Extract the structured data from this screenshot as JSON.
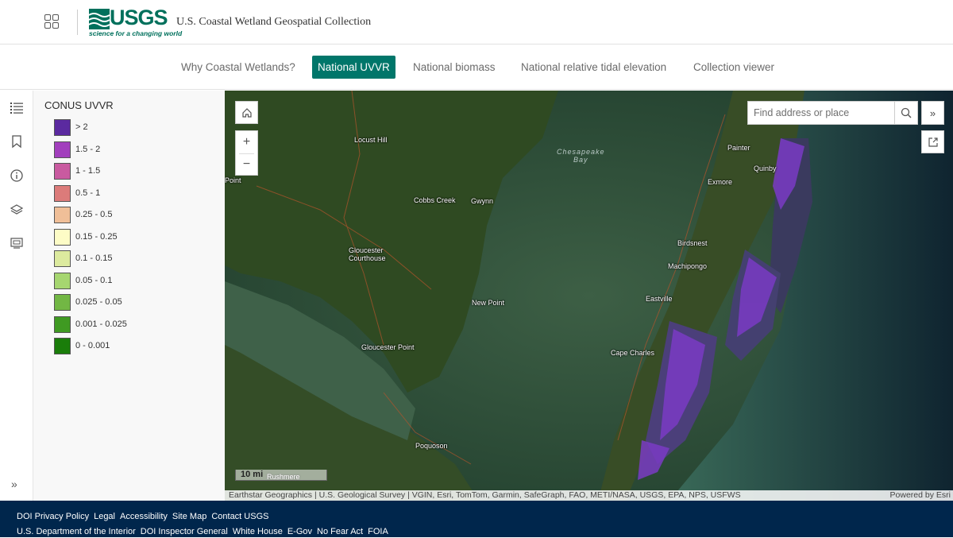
{
  "header": {
    "logo_text": "USGS",
    "logo_tagline": "science for a changing world",
    "site_title": "U.S. Coastal Wetland Geospatial Collection",
    "apps_icon": "grid-icon"
  },
  "nav": {
    "items": [
      {
        "label": "Why Coastal Wetlands?"
      },
      {
        "label": "National UVVR",
        "active": true
      },
      {
        "label": "National biomass"
      },
      {
        "label": "National relative tidal elevation"
      },
      {
        "label": "Collection viewer"
      }
    ]
  },
  "rail": {
    "icons": [
      "legend-list-icon",
      "bookmark-icon",
      "info-icon",
      "layers-icon",
      "basemap-gallery-icon"
    ],
    "expand_icon": "double-chevron-right-icon",
    "expand_label": "»"
  },
  "legend": {
    "title": "CONUS UVVR",
    "items": [
      {
        "label": "> 2",
        "color": "#5b2aa0"
      },
      {
        "label": "1.5 - 2",
        "color": "#a23fbd"
      },
      {
        "label": "1 - 1.5",
        "color": "#c95aa0"
      },
      {
        "label": "0.5 - 1",
        "color": "#dc7b7a"
      },
      {
        "label": "0.25 - 0.5",
        "color": "#f0bf98"
      },
      {
        "label": "0.15 - 0.25",
        "color": "#fdfcc6"
      },
      {
        "label": "0.1 - 0.15",
        "color": "#dcea9e"
      },
      {
        "label": "0.05 - 0.1",
        "color": "#a6d670"
      },
      {
        "label": "0.025 - 0.05",
        "color": "#72b744"
      },
      {
        "label": "0.001 - 0.025",
        "color": "#3f9a22"
      },
      {
        "label": "0 - 0.001",
        "color": "#1a7d0a"
      }
    ]
  },
  "map": {
    "water_label": "Chesapeake\nBay",
    "places": [
      {
        "label": "Point"
      },
      {
        "label": "Locust Hill"
      },
      {
        "label": "Cobbs Creek"
      },
      {
        "label": "Gwynn"
      },
      {
        "label": "Gloucester\nCourthouse"
      },
      {
        "label": "New Point"
      },
      {
        "label": "Gloucester Point"
      },
      {
        "label": "Poquoson"
      },
      {
        "label": "Rushmere"
      },
      {
        "label": "Painter"
      },
      {
        "label": "Quinby"
      },
      {
        "label": "Exmore"
      },
      {
        "label": "Birdsnest"
      },
      {
        "label": "Machipongo"
      },
      {
        "label": "Eastville"
      },
      {
        "label": "Cape Charles"
      }
    ],
    "search_placeholder": "Find address or place",
    "home_icon": "home-icon",
    "zoom_in_label": "+",
    "zoom_out_label": "−",
    "expand_label": "»",
    "scale_label": "10 mi",
    "attribution": "Earthstar Geographics | U.S. Geological Survey | VGIN, Esri, TomTom, Garmin, SafeGraph, FAO, METI/NASA, USGS, EPA, NPS, USFWS",
    "powered_by": "Powered by Esri"
  },
  "footer": {
    "row1": [
      "DOI Privacy Policy",
      "Legal",
      "Accessibility",
      "Site Map",
      "Contact USGS"
    ],
    "row2": [
      "U.S. Department of the Interior",
      "DOI Inspector General",
      "White House",
      "E-Gov",
      "No Fear Act",
      "FOIA"
    ]
  }
}
